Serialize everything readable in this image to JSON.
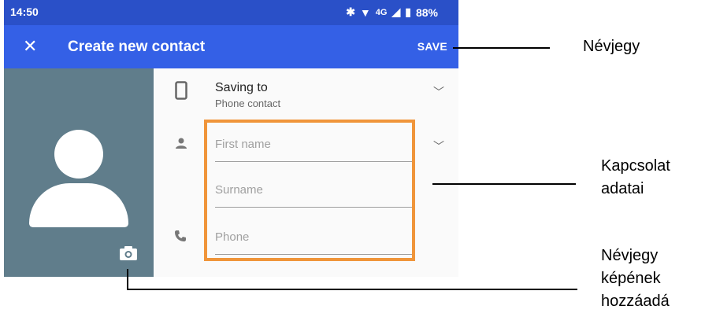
{
  "status_bar": {
    "time": "14:50",
    "network": "4G",
    "battery": "88%"
  },
  "app_bar": {
    "close_icon": "close-icon",
    "title": "Create new contact",
    "save_label": "SAVE"
  },
  "saving_to": {
    "title": "Saving to",
    "subtitle": "Phone contact"
  },
  "fields": {
    "first_name_placeholder": "First name",
    "surname_placeholder": "Surname",
    "phone_placeholder": "Phone"
  },
  "callouts": {
    "contact": "Névjegy",
    "details_line1": "Kapcsolat",
    "details_line2": "adatai",
    "photo_line1": "Névjegy",
    "photo_line2": "képének",
    "photo_line3": "hozzáadá"
  },
  "colors": {
    "status_bar": "#2a50c8",
    "app_bar": "#3460e6",
    "photo_bg": "#607d8b",
    "highlight": "#f0953a"
  }
}
